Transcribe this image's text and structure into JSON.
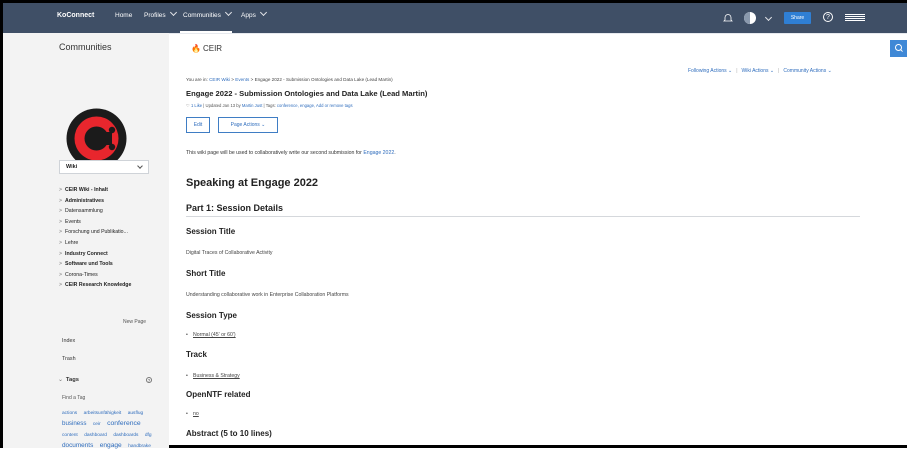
{
  "topnav": {
    "brand": "KoConnect",
    "home": "Home",
    "profiles": "Profiles",
    "communities": "Communities",
    "apps": "Apps",
    "share": "Share",
    "help": "?"
  },
  "sidebar": {
    "title": "Communities",
    "wiki_select": "Wiki",
    "tree": [
      {
        "label": "CEIR Wiki - Inhalt",
        "bold": true
      },
      {
        "label": "Administratives",
        "bold": true
      },
      {
        "label": "Datensammlung",
        "bold": false
      },
      {
        "label": "Events",
        "bold": false
      },
      {
        "label": "Forschung und Publikatio...",
        "bold": false
      },
      {
        "label": "Lehre",
        "bold": false
      },
      {
        "label": "Industry Connect",
        "bold": true
      },
      {
        "label": "Software und Tools",
        "bold": true
      },
      {
        "label": "Corona-Times",
        "bold": false
      },
      {
        "label": "CEIR Research Knowledge",
        "bold": true
      }
    ],
    "new_page": "New Page",
    "index": "Index",
    "trash": "Trash",
    "tags_heading": "Tags",
    "find_tag": "Find a Tag",
    "tags": [
      {
        "label": "actions",
        "size": 4.8
      },
      {
        "label": "arbeitsunfähigkeit",
        "size": 4.8
      },
      {
        "label": "ausflug",
        "size": 4.8
      },
      {
        "label": "business",
        "size": 6.2
      },
      {
        "label": "ceir",
        "size": 4.8
      },
      {
        "label": "conference",
        "size": 6.8
      },
      {
        "label": "content",
        "size": 4.8
      },
      {
        "label": "dashboard",
        "size": 4.8
      },
      {
        "label": "dashboards",
        "size": 4.8
      },
      {
        "label": "dfg",
        "size": 4.8
      },
      {
        "label": "documents",
        "size": 6.4
      },
      {
        "label": "engage",
        "size": 6.6
      },
      {
        "label": "handbrake",
        "size": 4.8
      }
    ]
  },
  "content": {
    "community_name": "CEIR",
    "actions": {
      "following": "Following Actions",
      "wiki": "Wiki Actions",
      "community": "Community Actions"
    },
    "breadcrumb": {
      "prefix": "You are in:",
      "wiki": "CEIR Wiki",
      "sep1": ">",
      "events": "Events",
      "sep2": ">",
      "current": "Engage 2022 - Submission Ontologies and Data Lake (Lead Martin)"
    },
    "page_title": "Engage 2022 - Submission Ontologies and Data Lake (Lead Martin)",
    "meta": {
      "like": "1 Like",
      "updated": "| Updated Jan 13 by",
      "author": "Martin Just",
      "tags_prefix": "| Tags:",
      "tags": "conference, engage,",
      "add_tags": "Add or remove tags"
    },
    "edit_button": "Edit",
    "page_actions_button": "Page Actions",
    "intro_text": "This wiki page will be used to collaboratively write our second submission for",
    "intro_link": "Engage 2022",
    "intro_end": ".",
    "h1": "Speaking at Engage 2022",
    "part1": "Part 1: Session Details",
    "session_title_label": "Session Title",
    "session_title_value": "Digital Traces of Collaborative Activity",
    "short_title_label": "Short Title",
    "short_title_value": "Understanding collaborative work in Enterprise Collaboration Platforms",
    "session_type_label": "Session Type",
    "session_type_value": "Normal (45' or 60')",
    "track_label": "Track",
    "track_value": "Business & Strategy",
    "openntf_label": "OpenNTF related",
    "openntf_value": "no",
    "abstract_label": "Abstract (5 to 10 lines)"
  }
}
